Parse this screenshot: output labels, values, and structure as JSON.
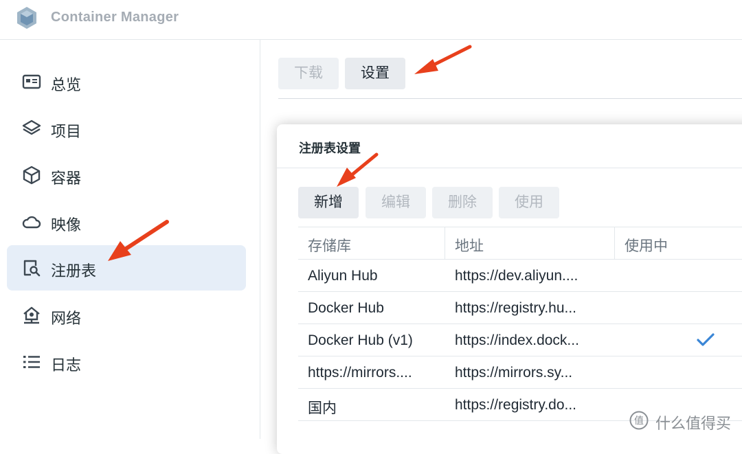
{
  "app": {
    "title": "Container Manager",
    "logo_icon": "container-manager-logo"
  },
  "sidebar": {
    "items": [
      {
        "label": "总览",
        "icon": "overview-card-icon",
        "active": false
      },
      {
        "label": "项目",
        "icon": "layers-icon",
        "active": false
      },
      {
        "label": "容器",
        "icon": "box-icon",
        "active": false
      },
      {
        "label": "映像",
        "icon": "cloud-icon",
        "active": false
      },
      {
        "label": "注册表",
        "icon": "registry-search-icon",
        "active": true
      },
      {
        "label": "网络",
        "icon": "network-home-icon",
        "active": false
      },
      {
        "label": "日志",
        "icon": "list-icon",
        "active": false
      }
    ]
  },
  "toolbar": {
    "download_label": "下载",
    "settings_label": "设置"
  },
  "dialog": {
    "title": "注册表设置",
    "buttons": {
      "add": "新增",
      "edit": "编辑",
      "delete": "删除",
      "use": "使用"
    },
    "columns": [
      "存储库",
      "地址",
      "使用中"
    ],
    "rows": [
      {
        "repo": "Aliyun Hub",
        "address": "https://dev.aliyun....",
        "in_use": false
      },
      {
        "repo": "Docker Hub",
        "address": "https://registry.hu...",
        "in_use": false
      },
      {
        "repo": "Docker Hub (v1)",
        "address": "https://index.dock...",
        "in_use": true
      },
      {
        "repo": "https://mirrors....",
        "address": "https://mirrors.sy...",
        "in_use": false
      },
      {
        "repo": "国内",
        "address": "https://registry.do...",
        "in_use": false
      }
    ]
  },
  "watermark": {
    "text": "什么值得买",
    "logo": "值"
  },
  "colors": {
    "accent": "#3a86d6",
    "active_bg": "#e6eef8",
    "arrow": "#e8401c"
  }
}
